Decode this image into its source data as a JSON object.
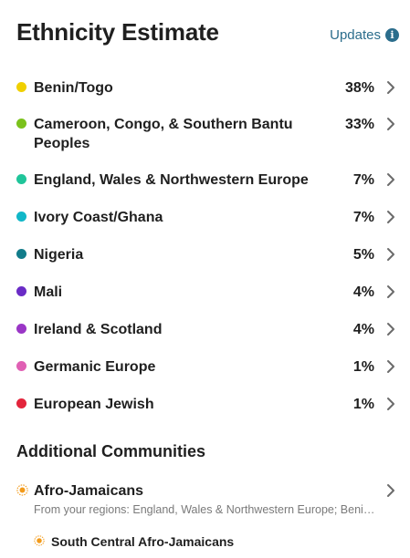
{
  "header": {
    "title": "Ethnicity Estimate",
    "updates_label": "Updates"
  },
  "regions": [
    {
      "name": "Benin/Togo",
      "percent": "38%",
      "color": "#f0d000"
    },
    {
      "name": "Cameroon, Congo, & Southern Bantu Peoples",
      "percent": "33%",
      "color": "#7bc21c"
    },
    {
      "name": "England, Wales & Northwestern Europe",
      "percent": "7%",
      "color": "#20c59a"
    },
    {
      "name": "Ivory Coast/Ghana",
      "percent": "7%",
      "color": "#11b7c8"
    },
    {
      "name": "Nigeria",
      "percent": "5%",
      "color": "#127c8a"
    },
    {
      "name": "Mali",
      "percent": "4%",
      "color": "#6a2cc6"
    },
    {
      "name": "Ireland & Scotland",
      "percent": "4%",
      "color": "#9a36c6"
    },
    {
      "name": "Germanic Europe",
      "percent": "1%",
      "color": "#e060b4"
    },
    {
      "name": "European Jewish",
      "percent": "1%",
      "color": "#e3253c"
    }
  ],
  "additional": {
    "title": "Additional Communities",
    "community": {
      "name": "Afro-Jamaicans",
      "subtitle": "From your regions: England, Wales & Northwestern Europe; Benin/Togo; Cameroon, Congo, & Southern Bantu Peoples",
      "color": "#f29a1a"
    },
    "sub_community": {
      "name": "South Central Afro-Jamaicans",
      "color": "#f29a1a"
    }
  }
}
